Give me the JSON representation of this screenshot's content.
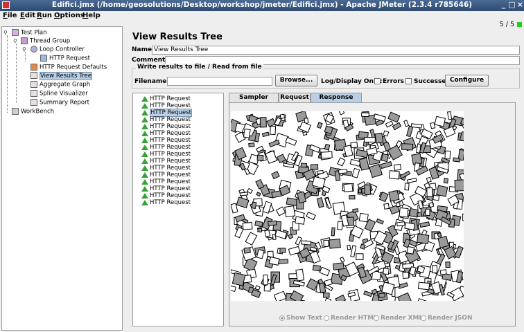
{
  "window": {
    "title": "Edifici.jmx (/home/geosolutions/Desktop/workshop/jmeter/Edifici.jmx) - Apache JMeter (2.3.4 r785646)",
    "minimize": "_",
    "maximize": "□",
    "close": "×"
  },
  "menu": [
    "File",
    "Edit",
    "Run",
    "Options",
    "Help"
  ],
  "status": {
    "count": "5 / 5",
    "led_color": "#22cc22"
  },
  "tree": {
    "test_plan": "Test Plan",
    "thread_group": "Thread Group",
    "loop_controller": "Loop Controller",
    "http_request": "HTTP Request",
    "http_request_defaults": "HTTP Request Defaults",
    "view_results_tree": "View Results Tree",
    "aggregate_graph": "Aggregate Graph",
    "spline_visualizer": "Spline Visualizer",
    "summary_report": "Summary Report",
    "workbench": "WorkBench"
  },
  "panel": {
    "title": "View Results Tree",
    "name_label": "Name:",
    "name_value": "View Results Tree",
    "comments_label": "Comments:",
    "comments_value": "",
    "write_results_legend": "Write results to file / Read from file",
    "filename_label": "Filename",
    "filename_value": "",
    "browse_button": "Browse...",
    "log_display_label": "Log/Display Only:",
    "errors_label": "Errors",
    "successes_label": "Successes",
    "configure_button": "Configure"
  },
  "results": [
    "HTTP Request",
    "HTTP Request",
    "HTTP Request",
    "HTTP Request",
    "HTTP Request",
    "HTTP Request",
    "HTTP Request",
    "HTTP Request",
    "HTTP Request",
    "HTTP Request",
    "HTTP Request",
    "HTTP Request",
    "HTTP Request",
    "HTTP Request",
    "HTTP Request",
    "HTTP Request"
  ],
  "tabs": {
    "sampler_result": "Sampler result",
    "request": "Request",
    "response_data": "Response data"
  },
  "render": {
    "show_text": "Show Text",
    "render_html": "Render HTML",
    "render_xml": "Render XML",
    "render_json": "Render JSON"
  }
}
